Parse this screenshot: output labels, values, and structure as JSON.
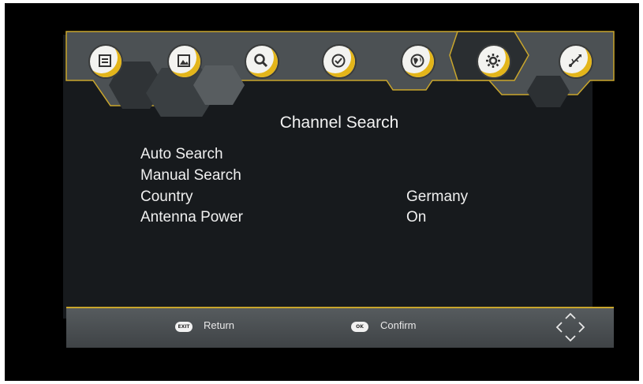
{
  "menu": {
    "icons": [
      "list-icon",
      "picture-icon",
      "search-icon",
      "clock-icon",
      "globe-icon",
      "gear-icon",
      "usb-icon"
    ],
    "selected_index": 5
  },
  "main": {
    "title": "Channel Search",
    "items": [
      {
        "label": "Auto Search",
        "value": ""
      },
      {
        "label": "Manual Search",
        "value": ""
      },
      {
        "label": "Country",
        "value": "Germany"
      },
      {
        "label": "Antenna Power",
        "value": "On"
      }
    ]
  },
  "footer": {
    "return_key": "EXIT",
    "return_label": "Return",
    "confirm_key": "OK",
    "confirm_label": "Confirm",
    "nav_icon": "direction-arrows-icon"
  },
  "colors": {
    "accent": "#d9b12a",
    "panel": "#171a1d",
    "toolbar": "#4f5458"
  }
}
